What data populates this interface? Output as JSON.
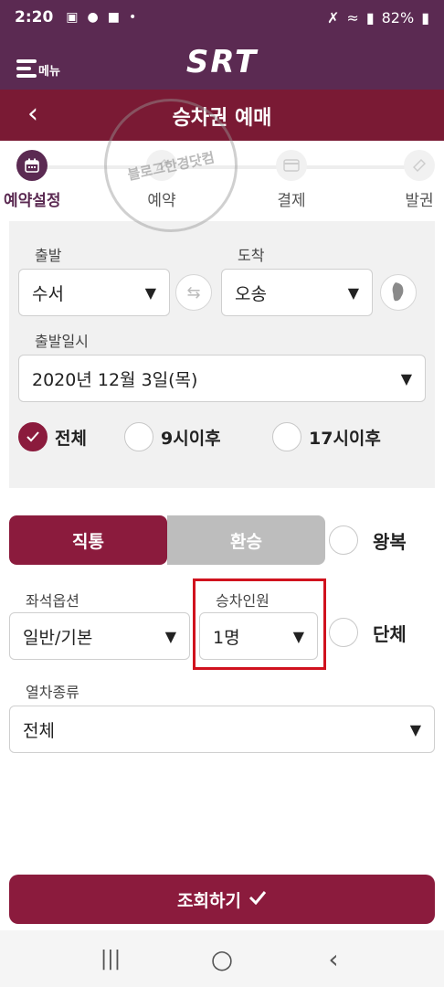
{
  "status_bar": {
    "time": "2:20",
    "battery": "82%"
  },
  "app_bar": {
    "menu_label": "메뉴",
    "logo": "SRT"
  },
  "title_bar": {
    "back": "‹",
    "title": "승차권 예매"
  },
  "stepper": {
    "steps": [
      {
        "label": "예약설정",
        "icon": "calendar-icon"
      },
      {
        "label": "예약",
        "icon": "pencil-icon"
      },
      {
        "label": "결제",
        "icon": "card-icon"
      },
      {
        "label": "발권",
        "icon": "ticket-icon"
      }
    ]
  },
  "route": {
    "departure_label": "출발",
    "departure_value": "수서",
    "arrival_label": "도착",
    "arrival_value": "오송",
    "swap_icon": "swap-icon",
    "map_icon": "korea-map-icon"
  },
  "date": {
    "label": "출발일시",
    "value": "2020년 12월 3일(목)"
  },
  "time_filter": {
    "options": [
      "전체",
      "9시이후",
      "17시이후"
    ],
    "selected": "전체"
  },
  "trip_type": {
    "direct": "직통",
    "transfer": "환승",
    "selected": "직통",
    "roundtrip_label": "왕복"
  },
  "seat_option": {
    "label": "좌석옵션",
    "value": "일반/기본"
  },
  "passengers": {
    "label": "승차인원",
    "value": "1명",
    "group_label": "단체"
  },
  "train_type": {
    "label": "열차종류",
    "value": "전체"
  },
  "search_button": {
    "label": "조회하기"
  },
  "watermark": {
    "text": "블로그한경닷컴"
  },
  "nav_bar": {
    "recent": "|||",
    "home": "○",
    "back": "‹"
  },
  "colors": {
    "brand_purple": "#5b2a52",
    "title_red": "#7a1a34",
    "accent": "#8b1b3d",
    "highlight": "#d0121e"
  }
}
